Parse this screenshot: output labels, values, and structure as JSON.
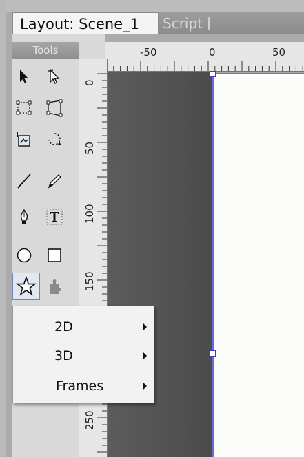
{
  "tabs": {
    "layout_label": "Layout: Scene_1",
    "script_label": "Script"
  },
  "tools_panel": {
    "header": "Tools",
    "tools": [
      {
        "name": "selection-arrow-icon"
      },
      {
        "name": "subselection-arrow-icon"
      },
      {
        "name": "transform-icon"
      },
      {
        "name": "distort-icon"
      },
      {
        "name": "crop-icon"
      },
      {
        "name": "rotate-icon"
      },
      {
        "name": "line-icon"
      },
      {
        "name": "pencil-icon"
      },
      {
        "name": "pen-icon"
      },
      {
        "name": "text-icon"
      },
      {
        "name": "ellipse-icon"
      },
      {
        "name": "rectangle-icon"
      },
      {
        "name": "star-icon",
        "selected": true
      },
      {
        "name": "component-icon"
      }
    ]
  },
  "ruler_top": {
    "labels": [
      "-50",
      "0",
      "50"
    ]
  },
  "ruler_left": {
    "labels": [
      "0",
      "50",
      "100",
      "150",
      "250"
    ]
  },
  "context_menu": {
    "items": [
      {
        "label": "2D"
      },
      {
        "label": "3D"
      },
      {
        "label": "Frames"
      }
    ]
  },
  "colors": {
    "stage_outline": "#6b6bd8",
    "tool_selected_border": "#6c88b4"
  }
}
